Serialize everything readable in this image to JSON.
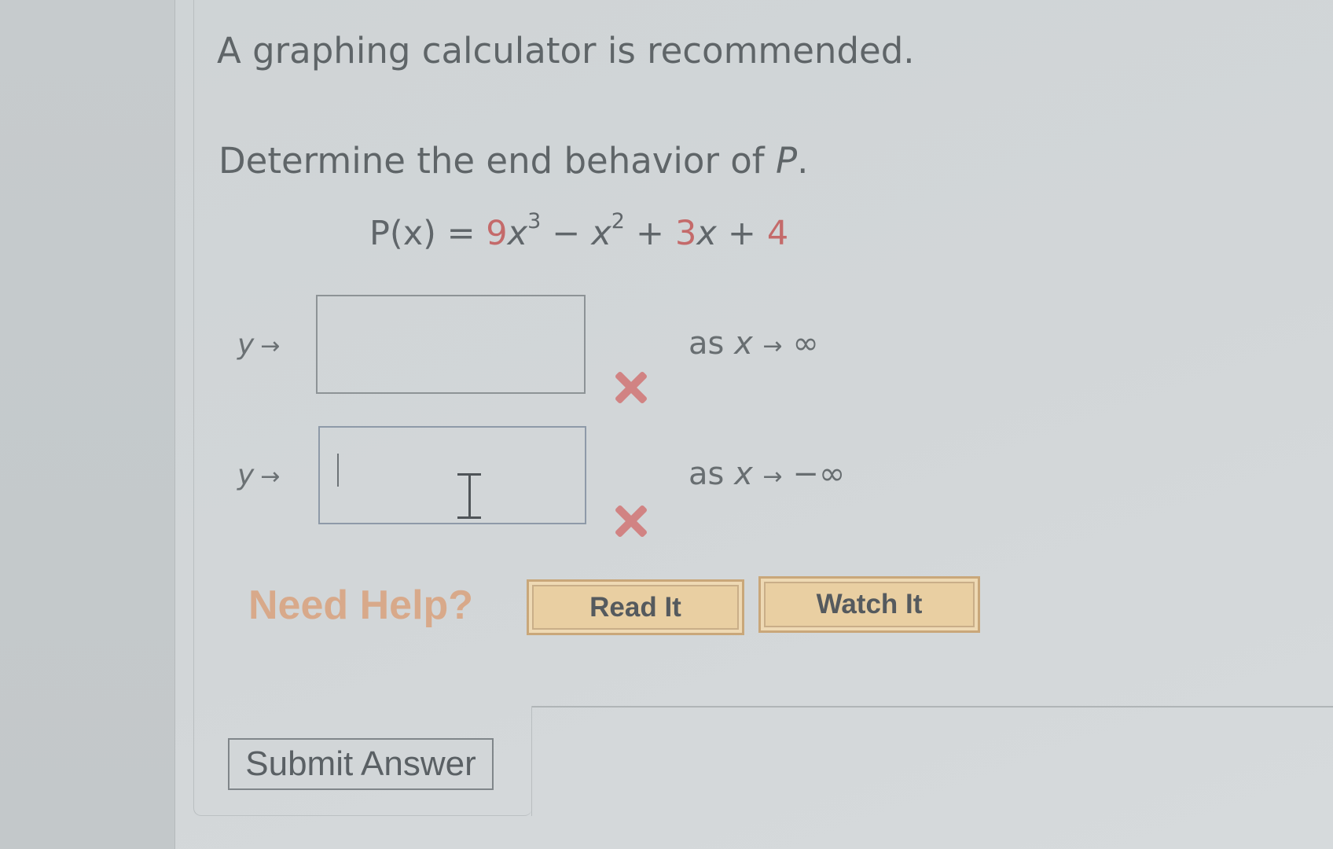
{
  "notice": "A graphing calculator is recommended.",
  "question": {
    "prompt_prefix": "Determine the end behavior of ",
    "prompt_var": "P",
    "prompt_suffix": ".",
    "equation": {
      "lhs": "P(x) = ",
      "term1_coef": "9",
      "term1_var": "x",
      "term1_exp": "3",
      "op1": "−",
      "term2_var": "x",
      "term2_exp": "2",
      "op2": "+",
      "term3_coef": "3",
      "term3_var": "x",
      "op3": "+",
      "term4_const": "4"
    }
  },
  "answers": [
    {
      "y_label": "y",
      "arrow": "→",
      "value": "",
      "condition_prefix": "as ",
      "condition_var": "x",
      "condition_arrow": "→",
      "condition_limit": "∞",
      "status": "incorrect"
    },
    {
      "y_label": "y",
      "arrow": "→",
      "value": "",
      "condition_prefix": "as ",
      "condition_var": "x",
      "condition_arrow": "→",
      "condition_limit": "−∞",
      "status": "incorrect"
    }
  ],
  "help": {
    "label": "Need Help?",
    "read_it": "Read It",
    "watch_it": "Watch It"
  },
  "submit_label": "Submit Answer",
  "colors": {
    "coefficient_red": "#c46a6a",
    "incorrect_mark": "#d18383",
    "need_help": "#d8a98a",
    "help_button_bg": "#e9cfa2"
  }
}
